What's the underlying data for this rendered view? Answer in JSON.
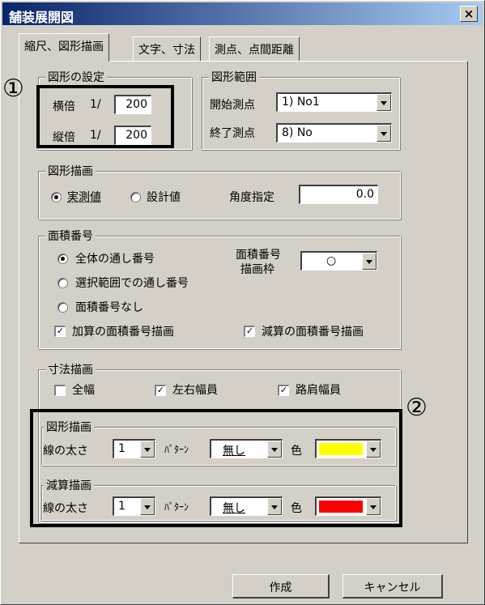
{
  "window": {
    "title": "舗装展開図",
    "close_label": "×"
  },
  "tabs": [
    {
      "label": "縮尺、図形描画",
      "active": true
    },
    {
      "label": "文字、寸法",
      "active": false
    },
    {
      "label": "測点、点間距離",
      "active": false
    }
  ],
  "scale_group": {
    "legend": "図形の設定",
    "horizontal_label": "横倍",
    "vertical_label": "縦倍",
    "ratio_prefix": "1/",
    "horizontal_value": "200",
    "vertical_value": "200"
  },
  "range_group": {
    "legend": "図形範囲",
    "start_label": "開始測点",
    "start_value": "1) No1",
    "end_label": "終了測点",
    "end_value": "8) No"
  },
  "draw_group": {
    "legend": "図形描画",
    "measured_label": "実測値",
    "design_label": "設計値",
    "angle_label": "角度指定",
    "angle_value": "0.0"
  },
  "area_group": {
    "legend": "面積番号",
    "opt_all": "全体の通し番号",
    "opt_range": "選択範囲での通し番号",
    "opt_none": "面積番号なし",
    "frame_label_1": "面積番号",
    "frame_label_2": "描画枠",
    "frame_value": "○",
    "add_label": "加算の面積番号描画",
    "sub_label": "減算の面積番号描画"
  },
  "dim_group": {
    "legend": "寸法描画",
    "full_label": "全幅",
    "lr_label": "左右幅員",
    "shoulder_label": "路肩幅員"
  },
  "fig_draw": {
    "legend": "図形描画",
    "width_label": "線の太さ",
    "width_value": "1",
    "pattern_label": "ﾊﾟﾀｰﾝ",
    "pattern_value": "無し",
    "color_label": "色",
    "color": "#ffff00"
  },
  "sub_draw": {
    "legend": "減算描画",
    "width_label": "線の太さ",
    "width_value": "1",
    "pattern_label": "ﾊﾟﾀｰﾝ",
    "pattern_value": "無し",
    "color_label": "色",
    "color": "#ff0000"
  },
  "buttons": {
    "create": "作成",
    "cancel": "キャンセル"
  },
  "annotations": {
    "marker_1": "①",
    "marker_2": "②"
  }
}
